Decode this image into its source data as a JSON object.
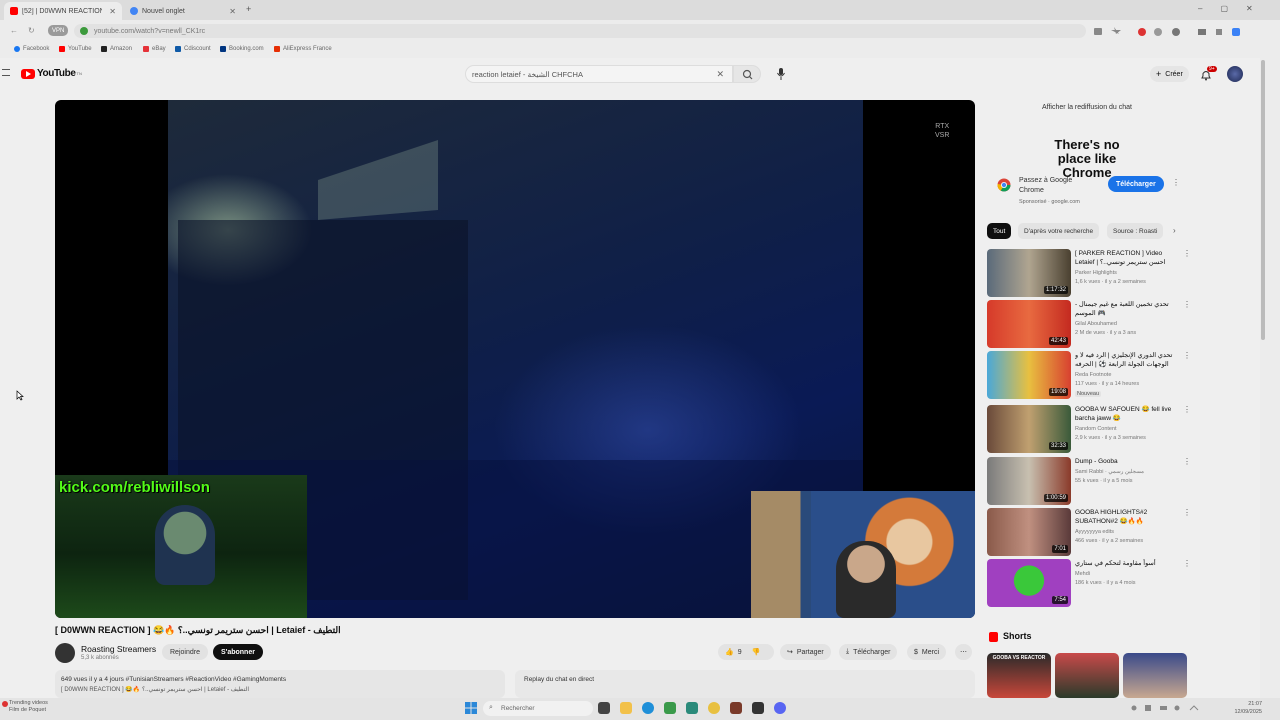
{
  "browser": {
    "tabs": [
      {
        "label": "[52] | D0WWN REACTION",
        "active": true
      },
      {
        "label": "Nouvel onglet",
        "active": false
      }
    ],
    "new_tab_label": "+",
    "omnibox_url": "youtube.com/watch?v=newll_CK1rc",
    "vpn_label": "VPN",
    "bookmarks": [
      "Facebook",
      "YouTube",
      "Amazon",
      "eBay",
      "Cdiscount",
      "Booking.com",
      "AliExpress France"
    ]
  },
  "youtube": {
    "logo_text": "YouTube",
    "logo_region": "TN",
    "search_query": "reaction letaief - الشيخة CHFCHA",
    "create_label": "Créer",
    "notif_count": "9+",
    "player": {
      "rtx_label": "RTX\nVSR",
      "overlay_text": "kick.com/rebliwillson"
    },
    "video": {
      "title": "[ D0WWN REACTION ] 😂🔥 احسن ستريمر تونسي..؟ | Letaief - التطيف",
      "channel": "Roasting Streamers",
      "subscribers": "5,3 k abonnés",
      "join_label": "Rejoindre",
      "subscribe_label": "S'abonner",
      "likes": "9",
      "share_label": "Partager",
      "download_label": "Télécharger",
      "thanks_label": "Merci",
      "more_label": "⋯",
      "views_date": "649 vues  il y a 4 jours  #TunisianStreamers #ReactionVideo #GamingMoments",
      "desc_line": "[ D0WWN REACTION ] 😂🔥 احسن ستريمر تونسي..؟ | Letaief - التطيف"
    },
    "chat_replay_label": "Replay du chat en direct",
    "sidebar": {
      "chat_show_label": "Afficher la rediffusion du chat",
      "ad": {
        "headline": "There's no place like Chrome",
        "body": "Passez à Google Chrome",
        "sponsor": "Sponsorisé · google.com",
        "button": "Télécharger"
      },
      "chips": [
        "Tout",
        "D'après votre recherche",
        "Source : Roasti"
      ],
      "videos": [
        {
          "title": "[ PARKER REACTION ] Video Letaief | احسن ستريمر تونسي..؟",
          "channel": "Parker Highlights",
          "meta": "1,6 k vues · il y a 2 semaines",
          "duration": "1:17:32"
        },
        {
          "title": "تحدي تخمين اللعبة مع غيم جيمنال - الموسم 🎮",
          "channel": "Gilal Abouhamed",
          "meta": "2 M de vues · il y a 3 ans",
          "duration": "42:43"
        },
        {
          "title": "تحدي الدوري الإنجليزي | الرد فيه لا و الوجهات الجولة الرابعة ⚽ | الحرفه",
          "channel": "Reda Footnote",
          "meta": "117 vues · il y a 14 heures",
          "badge": "Nouveau",
          "duration": "19:08"
        },
        {
          "title": "GOOBA W SAFOUEN 😂 fell live barcha jaww 😂",
          "channel": "Random Content",
          "meta": "2,9 k vues · il y a 3 semaines",
          "duration": "32:33"
        },
        {
          "title": "Dump - Gooba",
          "channel": "Sami Rabbi · مسجلين رسمي",
          "meta": "55 k vues · il y a 5 mois",
          "duration": "1:00:59"
        },
        {
          "title": "GOOBA HIGHLIGHTS#2 SUBATHON#2 😂🔥🔥",
          "channel": "Ayyyyyyya edits",
          "meta": "466 vues · il y a 2 semaines",
          "duration": "7:01"
        },
        {
          "title": "أسوأ مقاومة لتحكم في ستاري",
          "channel": "Mehdi",
          "meta": "186 k vues · il y a 4 mois",
          "duration": "7:54"
        }
      ],
      "shorts_title": "Shorts",
      "shorts_first_overlay": "GOOBA VS REACTOR"
    }
  },
  "taskbar": {
    "weather_line1": "Trending videos",
    "weather_line2": "Film de Poquet",
    "search_placeholder": "Rechercher",
    "time": "21:07",
    "date": "12/09/2025"
  },
  "colors": {
    "youtube_red": "#ff0000",
    "chrome_blue": "#1a73e8",
    "kick_green": "#53fc18"
  }
}
